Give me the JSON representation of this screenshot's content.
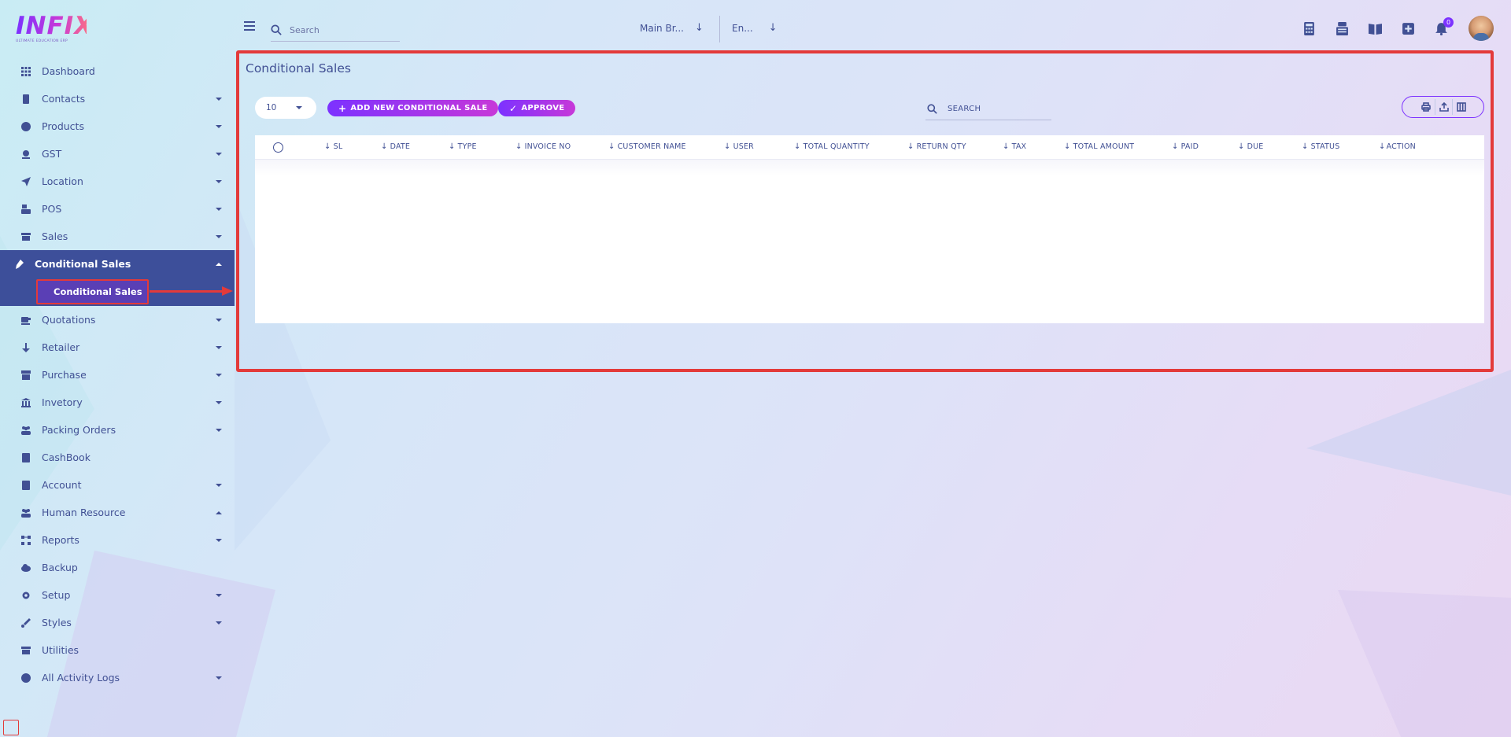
{
  "brand": {
    "name": "INFIX",
    "tagline": "ULTIMATE EDUCATION ERP"
  },
  "topbar": {
    "search_placeholder": "Search",
    "branch_select": "Main Br...",
    "language_select": "En...",
    "select_arrow": "↓",
    "notifications_count": "0"
  },
  "sidebar": {
    "items": [
      {
        "label": "Dashboard",
        "icon": "dashboard-icon",
        "has_caret": false
      },
      {
        "label": "Contacts",
        "icon": "contacts-icon",
        "has_caret": true
      },
      {
        "label": "Products",
        "icon": "products-icon",
        "has_caret": true
      },
      {
        "label": "GST",
        "icon": "gst-icon",
        "has_caret": true
      },
      {
        "label": "Location",
        "icon": "location-icon",
        "has_caret": true
      },
      {
        "label": "POS",
        "icon": "pos-icon",
        "has_caret": true
      },
      {
        "label": "Sales",
        "icon": "sales-icon",
        "has_caret": true
      },
      {
        "label": "Conditional Sales",
        "icon": "conditional-sales-icon",
        "has_caret": true,
        "active": true
      },
      {
        "label": "Quotations",
        "icon": "quotations-icon",
        "has_caret": true
      },
      {
        "label": "Retailer",
        "icon": "retailer-icon",
        "has_caret": true
      },
      {
        "label": "Purchase",
        "icon": "purchase-icon",
        "has_caret": true
      },
      {
        "label": "Invetory",
        "icon": "inventory-icon",
        "has_caret": true
      },
      {
        "label": "Packing Orders",
        "icon": "packing-orders-icon",
        "has_caret": true
      },
      {
        "label": "CashBook",
        "icon": "cashbook-icon",
        "has_caret": false
      },
      {
        "label": "Account",
        "icon": "account-icon",
        "has_caret": true
      },
      {
        "label": "Human Resource",
        "icon": "human-resource-icon",
        "has_caret": true
      },
      {
        "label": "Reports",
        "icon": "reports-icon",
        "has_caret": true
      },
      {
        "label": "Backup",
        "icon": "backup-icon",
        "has_caret": false
      },
      {
        "label": "Setup",
        "icon": "setup-icon",
        "has_caret": true
      },
      {
        "label": "Styles",
        "icon": "styles-icon",
        "has_caret": true
      },
      {
        "label": "Utilities",
        "icon": "utilities-icon",
        "has_caret": false
      },
      {
        "label": "All Activity Logs",
        "icon": "activity-logs-icon",
        "has_caret": true
      }
    ],
    "sub_item": "Conditional Sales"
  },
  "main": {
    "title": "Conditional Sales",
    "per_page": "10",
    "add_button": "ADD NEW CONDITIONAL SALE",
    "add_button_prefix": "+",
    "approve_button": "APPROVE",
    "approve_button_prefix": "✓",
    "search_placeholder": "SEARCH",
    "sort_arrow": "↓",
    "columns": [
      "SL",
      "DATE",
      "TYPE",
      "INVOICE NO",
      "CUSTOMER NAME",
      "USER",
      "TOTAL QUANTITY",
      "RETURN QTY",
      "TAX",
      "TOTAL AMOUNT",
      "PAID",
      "DUE",
      "STATUS",
      "ACTION"
    ]
  },
  "colors": {
    "accent_start": "#7c32ff",
    "accent_end": "#c738d8",
    "text": "#415094",
    "active_nav": "#3d4f9a",
    "highlight": "#e33a3a"
  }
}
